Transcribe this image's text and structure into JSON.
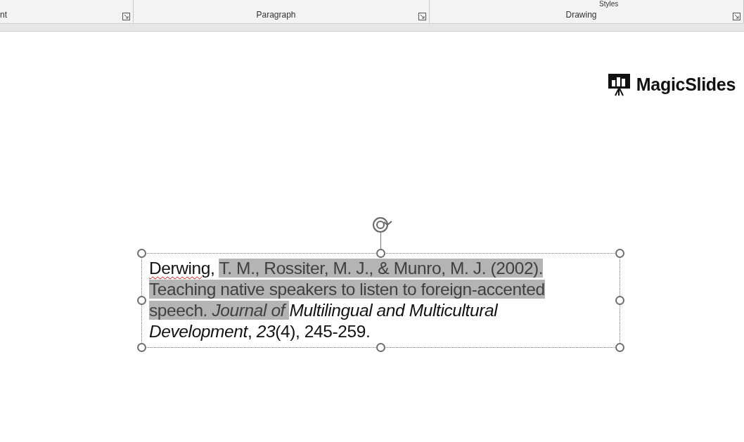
{
  "ribbon": {
    "groups": [
      {
        "label": "nt"
      },
      {
        "label": "Paragraph"
      },
      {
        "label": "Drawing"
      }
    ],
    "styles_label": "Styles"
  },
  "logo": {
    "text": "MagicSlides"
  },
  "citation": {
    "segments": [
      {
        "kind": "misspelled",
        "text": "Derwing",
        "selected": false
      },
      {
        "kind": "plain",
        "text": ", ",
        "selected": false
      },
      {
        "kind": "plain",
        "text": "T. M., Rossiter, M. J., & Munro, M. J. (2002). Teaching native speakers to listen to foreign-accented speech. *Journal of* ",
        "selected": true
      },
      {
        "kind": "plain",
        "text": "*Multilingual and Multicultural Development*, *23*(4), 245-259.",
        "selected": false
      }
    ]
  }
}
